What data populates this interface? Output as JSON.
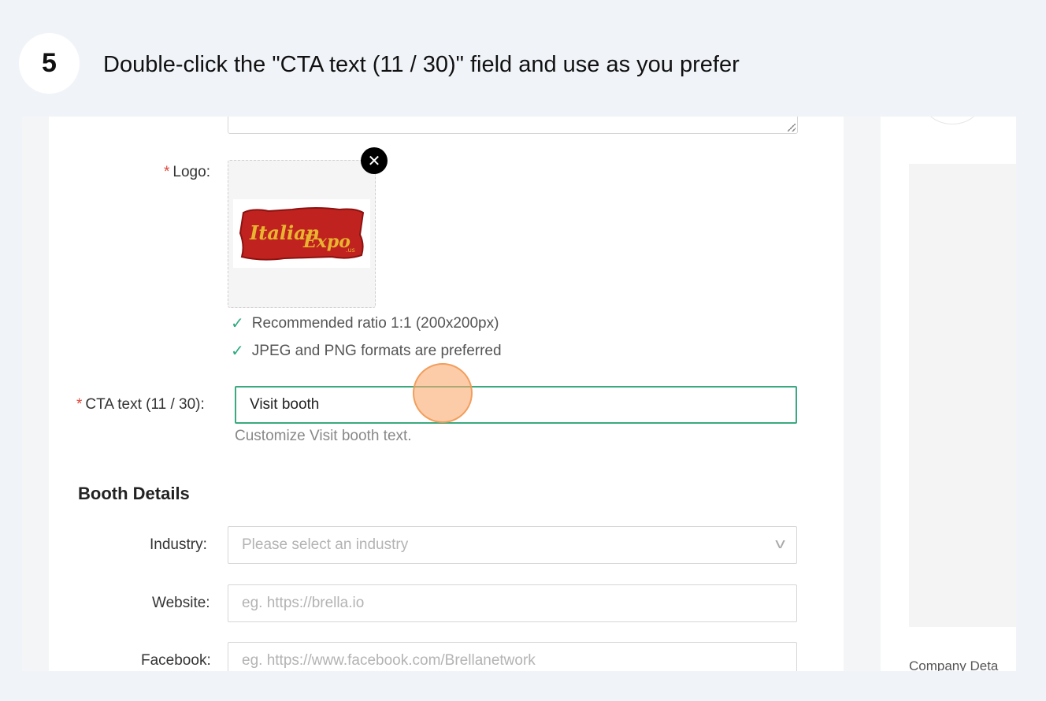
{
  "step": {
    "number": "5",
    "instruction": "Double-click the \"CTA text (11 / 30)\" field and use as you prefer"
  },
  "form": {
    "logo": {
      "required_mark": "*",
      "label": "Logo",
      "colon": ":",
      "remove_icon": "close-icon",
      "image_alt": "ItalianExpo logo"
    },
    "hints": [
      "Recommended ratio 1:1 (200x200px)",
      "JPEG and PNG formats are preferred"
    ],
    "cta": {
      "required_mark": "*",
      "label": "CTA text (11 / 30)",
      "colon": ":",
      "value": "Visit booth",
      "help": "Customize Visit booth text."
    },
    "booth_details": {
      "title": "Booth Details",
      "industry": {
        "label": "Industry",
        "colon": ":",
        "placeholder": "Please select an industry"
      },
      "website": {
        "label": "Website",
        "colon": ":",
        "placeholder": "eg. https://brella.io"
      },
      "facebook": {
        "label": "Facebook",
        "colon": ":",
        "placeholder": "eg. https://www.facebook.com/Brellanetwork"
      }
    }
  },
  "right_panel": {
    "label": "Company Deta"
  },
  "colors": {
    "accent": "#3aa97f",
    "required": "#e0463c",
    "click_marker": "#f5a46a"
  }
}
